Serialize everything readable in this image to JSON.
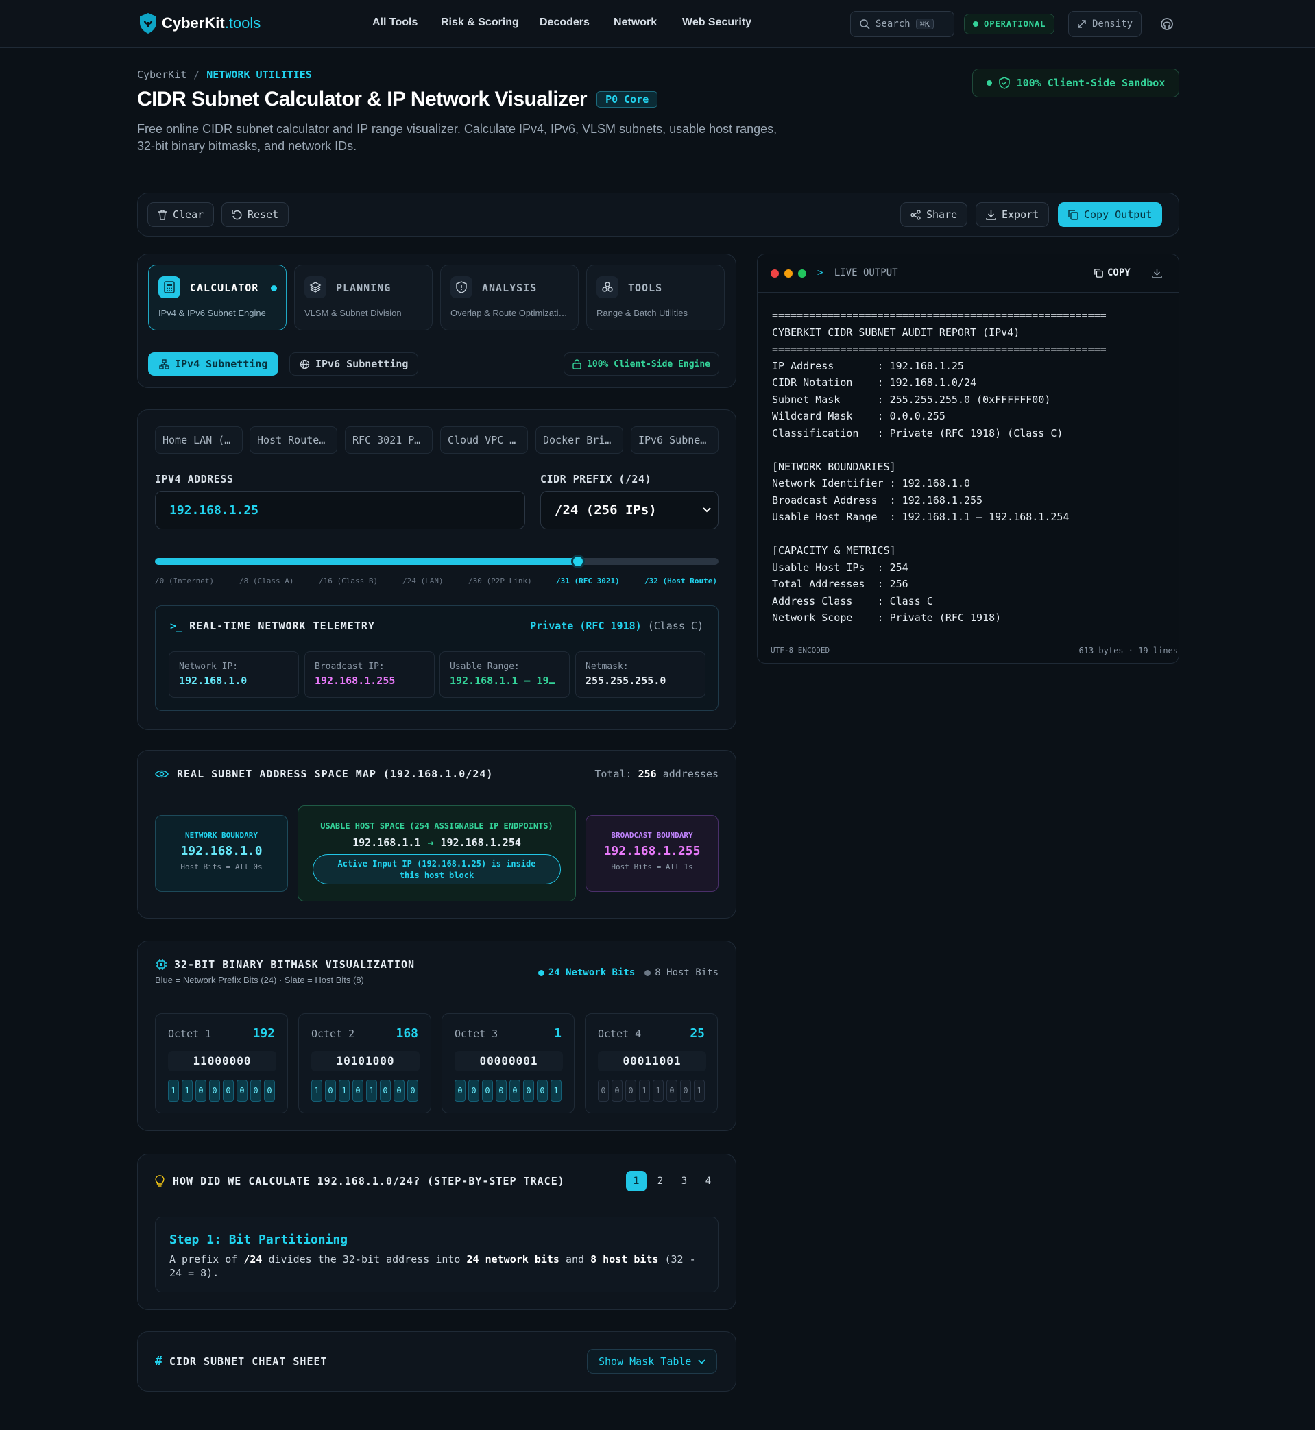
{
  "nav": {
    "logo_main": "CyberKit",
    "logo_ext": ".tools",
    "links": [
      "All Tools",
      "Risk & Scoring",
      "Decoders",
      "Network",
      "Web Security"
    ],
    "search_label": "Search",
    "search_kbd": "⌘K",
    "status": "OPERATIONAL",
    "density": "Density"
  },
  "header": {
    "breadcrumb_root": "CyberKit",
    "breadcrumb_sep": "/",
    "breadcrumb_current": "NETWORK UTILITIES",
    "title": "CIDR Subnet Calculator & IP Network Visualizer",
    "badge": "P0 Core",
    "description_line1": "Free online CIDR subnet calculator and IP range visualizer. Calculate IPv4, IPv6, VLSM subnets, usable host ranges,",
    "description_line2": "32-bit binary bitmasks, and network IDs.",
    "sandbox": "100% Client-Side Sandbox"
  },
  "toolbar": {
    "clear": "Clear",
    "reset": "Reset",
    "share": "Share",
    "export": "Export",
    "copy_output": "Copy Output"
  },
  "modes": [
    {
      "title": "CALCULATOR",
      "subtitle": "IPv4 & IPv6 Subnet Engine",
      "active": true
    },
    {
      "title": "PLANNING",
      "subtitle": "VLSM & Subnet Division",
      "active": false
    },
    {
      "title": "ANALYSIS",
      "subtitle": "Overlap & Route Optimizati…",
      "active": false
    },
    {
      "title": "TOOLS",
      "subtitle": "Range & Batch Utilities",
      "active": false
    }
  ],
  "subtabs": {
    "ipv4": "IPv4 Subnetting",
    "ipv6": "IPv6 Subnetting",
    "engine": "100% Client-Side Engine"
  },
  "presets": [
    "Home LAN (…",
    "Host Route…",
    "RFC 3021 P…",
    "Cloud VPC …",
    "Docker Bri…",
    "IPv6 Subne…"
  ],
  "inputs": {
    "ipv4_label": "IPV4 ADDRESS",
    "ipv4_value": "192.168.1.25",
    "cidr_label": "CIDR PREFIX (/24)",
    "cidr_value": "/24 (256 IPs)",
    "slider_fraction": 0.75
  },
  "slider_ticks": [
    "/0 (Internet)",
    "/8 (Class A)",
    "/16 (Class B)",
    "/24 (LAN)",
    "/30 (P2P Link)",
    "/31 (RFC 3021)",
    "/32 (Host Route)"
  ],
  "telemetry": {
    "title": "REAL-TIME NETWORK TELEMETRY",
    "scope": "Private (RFC 1918)",
    "class": "(Class C)",
    "cards": [
      {
        "label": "Network IP:",
        "value": "192.168.1.0",
        "color": "#67e8f9"
      },
      {
        "label": "Broadcast IP:",
        "value": "192.168.1.255",
        "color": "#e879f9"
      },
      {
        "label": "Usable Range:",
        "value": "192.168.1.1 – 19…",
        "color": "#34d399"
      },
      {
        "label": "Netmask:",
        "value": "255.255.255.0",
        "color": "#e6edf3"
      }
    ]
  },
  "space_map": {
    "title": "REAL SUBNET ADDRESS SPACE MAP (192.168.1.0/24)",
    "total_label": "Total:",
    "total_value": "256",
    "total_unit": "addresses",
    "network_label": "NETWORK BOUNDARY",
    "network_ip": "192.168.1.0",
    "network_note": "Host Bits = All 0s",
    "usable_label": "USABLE HOST SPACE (254 ASSIGNABLE IP ENDPOINTS)",
    "usable_start": "192.168.1.1",
    "usable_end": "192.168.1.254",
    "active_note_line1": "Active Input IP (192.168.1.25) is inside",
    "active_note_line2": "this host block",
    "broadcast_label": "BROADCAST BOUNDARY",
    "broadcast_ip": "192.168.1.255",
    "broadcast_note": "Host Bits = All 1s"
  },
  "bitmask": {
    "title": "32-BIT BINARY BITMASK VISUALIZATION",
    "subtitle": "Blue = Network Prefix Bits (24) · Slate = Host Bits (8)",
    "legend_network": "24 Network Bits",
    "legend_host": "8 Host Bits",
    "octets": [
      {
        "name": "Octet 1",
        "value": "192",
        "binary": "11000000",
        "network": true
      },
      {
        "name": "Octet 2",
        "value": "168",
        "binary": "10101000",
        "network": true
      },
      {
        "name": "Octet 3",
        "value": "1",
        "binary": "00000001",
        "network": true
      },
      {
        "name": "Octet 4",
        "value": "25",
        "binary": "00011001",
        "network": false
      }
    ]
  },
  "trace": {
    "title": "HOW DID WE CALCULATE 192.168.1.0/24? (STEP-BY-STEP TRACE)",
    "steps": [
      "1",
      "2",
      "3",
      "4"
    ],
    "step_title": "Step 1: Bit Partitioning",
    "t1": "A prefix of ",
    "t2": "/24",
    "t3": " divides the 32-bit address into ",
    "t4": "24 network bits",
    "t5": " and ",
    "t6": "8 host bits",
    "t7": " (32 -",
    "t8": "24 = 8)."
  },
  "cheatsheet": {
    "title": "CIDR SUBNET CHEAT SHEET",
    "button": "Show Mask Table"
  },
  "output": {
    "title": "LIVE_OUTPUT",
    "copy": "COPY",
    "lines": [
      "======================================================",
      "CYBERKIT CIDR SUBNET AUDIT REPORT (IPv4)",
      "======================================================",
      "IP Address       : 192.168.1.25",
      "CIDR Notation    : 192.168.1.0/24",
      "Subnet Mask      : 255.255.255.0 (0xFFFFFF00)",
      "Wildcard Mask    : 0.0.0.255",
      "Classification   : Private (RFC 1918) (Class C)",
      "",
      "[NETWORK BOUNDARIES]",
      "Network Identifier : 192.168.1.0",
      "Broadcast Address  : 192.168.1.255",
      "Usable Host Range  : 192.168.1.1 – 192.168.1.254",
      "",
      "[CAPACITY & METRICS]",
      "Usable Host IPs  : 254",
      "Total Addresses  : 256",
      "Address Class    : Class C",
      "Network Scope    : Private (RFC 1918)"
    ],
    "encoding": "UTF-8 ENCODED",
    "stats": "613 bytes · 19 lines"
  },
  "colors": {
    "accent": "#22d3ee",
    "success": "#34d399",
    "broadcast": "#e879f9"
  }
}
